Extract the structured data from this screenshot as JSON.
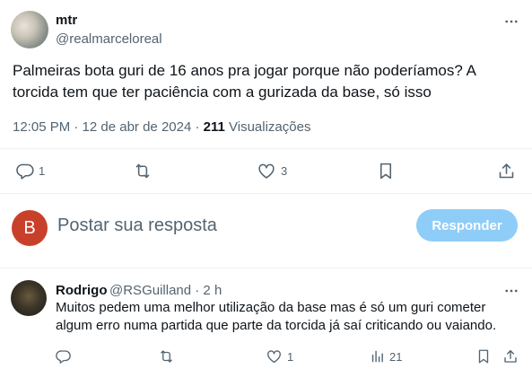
{
  "tweet": {
    "display_name": "mtr",
    "handle": "@realmarceloreal",
    "text": "Palmeiras bota guri de 16 anos pra jogar porque não poderíamos? A torcida tem que ter paciência com a gurizada da base, só isso",
    "time": "12:05 PM · 12 de abr de 2024 · ",
    "views_count": "211",
    "views_label": " Visualizações",
    "actions": {
      "reply_count": "1",
      "retweet_count": "",
      "like_count": "3"
    }
  },
  "composer": {
    "avatar_letter": "B",
    "placeholder": "Postar sua resposta",
    "button_label": "Responder"
  },
  "reply": {
    "display_name": "Rodrigo",
    "handle_time": "@RSGuilland · 2 h",
    "text": "Muitos pedem uma melhor utilização da base mas é só um guri cometer algum erro numa partida que parte da torcida já saí criticando ou vaiando.",
    "actions": {
      "reply_count": "",
      "retweet_count": "",
      "like_count": "1",
      "views_count": "21"
    }
  },
  "colors": {
    "text_primary": "#0f1419",
    "text_secondary": "#536471",
    "button_disabled": "#8ecdf8",
    "avatar_b": "#c9402a",
    "divider": "#eff3f4"
  },
  "icons": [
    "more-icon",
    "reply-icon",
    "retweet-icon",
    "like-icon",
    "bookmark-icon",
    "share-icon",
    "views-icon"
  ]
}
